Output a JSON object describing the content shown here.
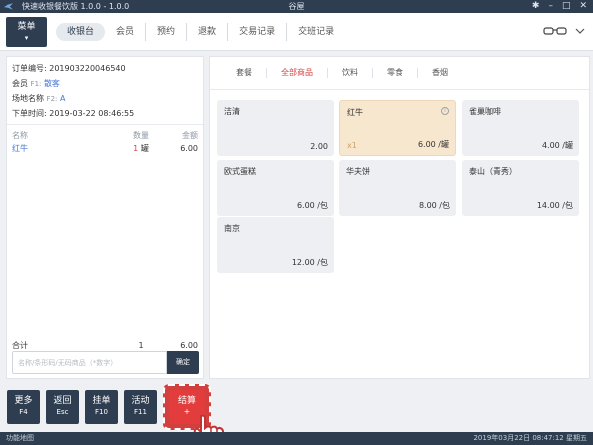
{
  "titlebar": {
    "app_title": "快速收银餐饮版 1.0.0 - 1.0.0",
    "center_title": "谷屋",
    "icons": [
      "gear-icon",
      "minimize-icon",
      "maximize-icon",
      "close-icon"
    ]
  },
  "nav": {
    "menu_label": "菜单",
    "tabs": [
      {
        "label": "收银台",
        "active": true
      },
      {
        "label": "会员",
        "active": false
      },
      {
        "label": "预约",
        "active": false
      },
      {
        "label": "退款",
        "active": false
      },
      {
        "label": "交易记录",
        "active": false
      },
      {
        "label": "交班记录",
        "active": false
      }
    ],
    "right_icons": [
      "glasses-icon",
      "chevron-down-icon"
    ]
  },
  "order": {
    "order_no_label": "订单编号:",
    "order_no": "201903220046540",
    "member_label": "会员",
    "member_key": "F1:",
    "member_value": "散客",
    "area_label": "场地名称",
    "area_key": "F2:",
    "area_value": "A",
    "time_label": "下单时间:",
    "time_value": "2019-03-22 08:46:55"
  },
  "items": {
    "headers": {
      "name": "名称",
      "qty": "数量",
      "amount": "金额"
    },
    "rows": [
      {
        "name": "红牛",
        "qty": "1",
        "unit": "罐",
        "amount": "6.00"
      }
    ],
    "total_label": "合计",
    "total_qty": "1",
    "total_amount": "6.00"
  },
  "search": {
    "placeholder": "名称/条形码/无码商品（*数字）",
    "confirm_label": "确定"
  },
  "functions": [
    {
      "label": "更多",
      "key": "F4"
    },
    {
      "label": "返回",
      "key": "Esc"
    },
    {
      "label": "挂单",
      "key": "F10"
    },
    {
      "label": "活动",
      "key": "F11"
    }
  ],
  "checkout": {
    "label": "结算",
    "key": "+"
  },
  "categories": [
    {
      "label": "套餐",
      "active": false
    },
    {
      "label": "全部商品",
      "active": true
    },
    {
      "label": "饮料",
      "active": false
    },
    {
      "label": "零食",
      "active": false
    },
    {
      "label": "香烟",
      "active": false
    }
  ],
  "products": [
    {
      "name": "洁清",
      "price": "2.00",
      "unit": "",
      "selected": false,
      "qty": ""
    },
    {
      "name": "红牛",
      "price": "6.00",
      "unit": "/罐",
      "selected": true,
      "qty": "x1"
    },
    {
      "name": "雀巢咖啡",
      "price": "4.00",
      "unit": "/罐",
      "selected": false,
      "qty": ""
    },
    {
      "name": "欧式蛋糕",
      "price": "6.00",
      "unit": "/包",
      "selected": false,
      "qty": ""
    },
    {
      "name": "华夫饼",
      "price": "8.00",
      "unit": "/包",
      "selected": false,
      "qty": ""
    },
    {
      "name": "泰山（青秀）",
      "price": "14.00",
      "unit": "/包",
      "selected": false,
      "qty": ""
    },
    {
      "name": "南京",
      "price": "12.00",
      "unit": "/包",
      "selected": false,
      "qty": ""
    }
  ],
  "statusbar": {
    "left": "功能地图",
    "right": "2019年03月22日 08:47:12 星期五"
  },
  "colors": {
    "primary": "#2e3d50",
    "accent_red": "#e23c3c",
    "link_blue": "#4a79d8",
    "selected_card": "#f8e7cf"
  }
}
